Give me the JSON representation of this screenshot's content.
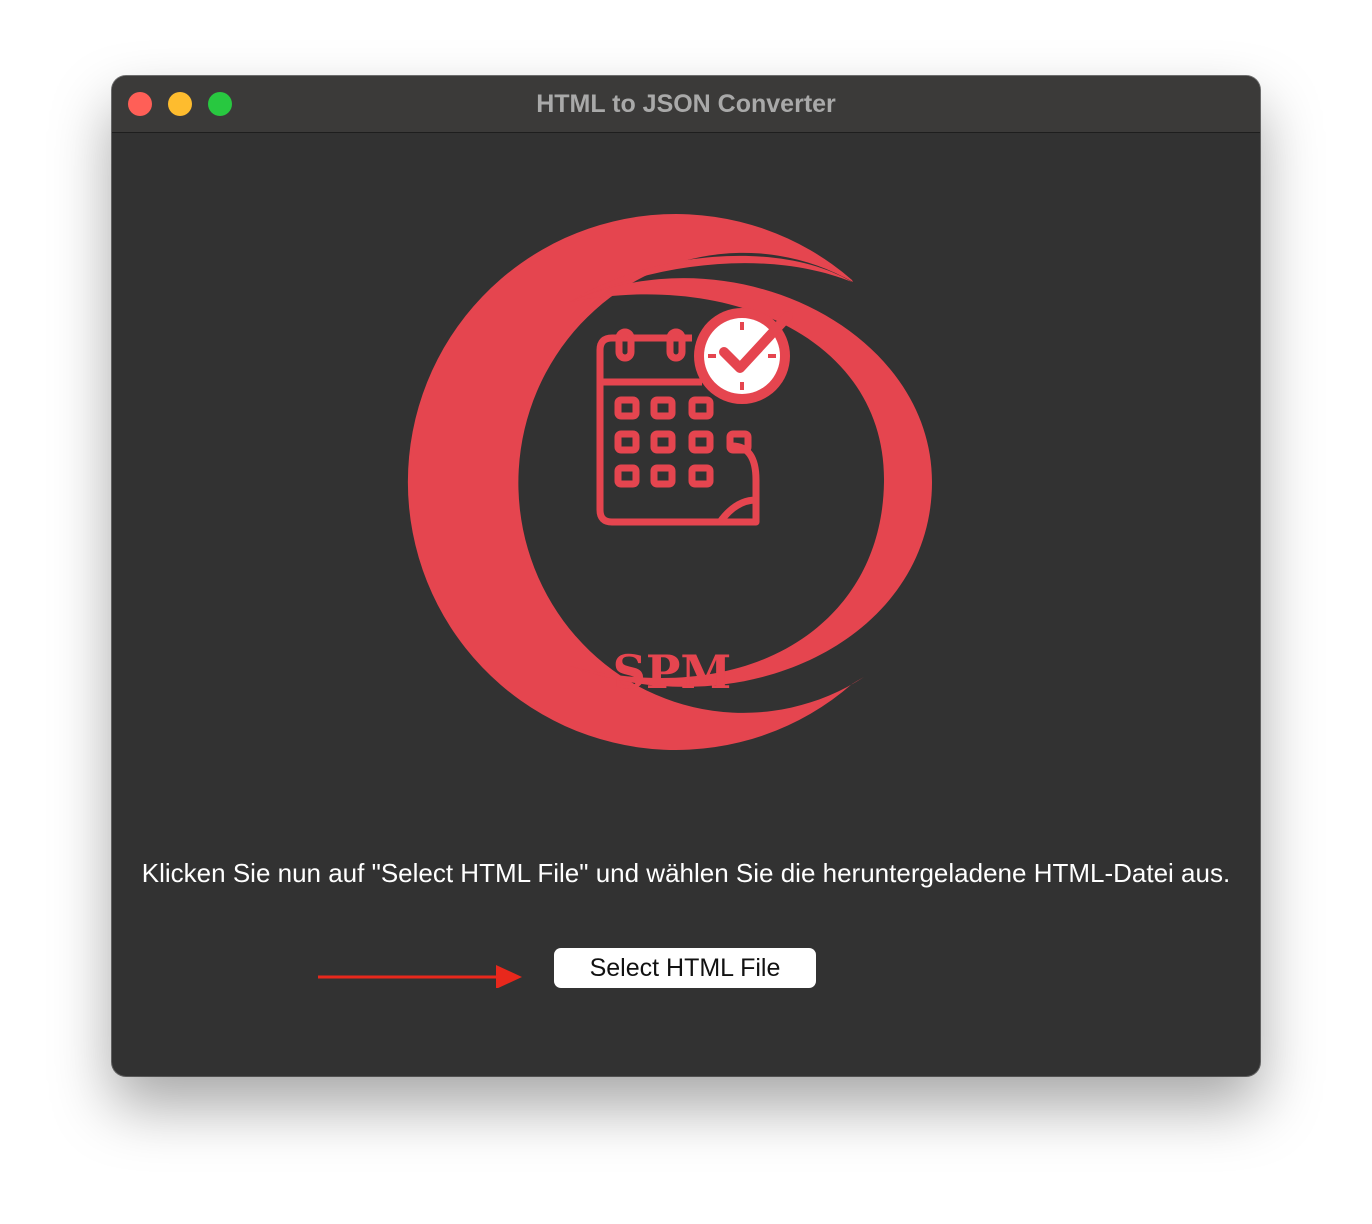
{
  "window": {
    "title": "HTML to JSON Converter"
  },
  "logo": {
    "text": "SPM",
    "accent_color": "#e5454f"
  },
  "main": {
    "instruction": "Klicken Sie nun auf \"Select HTML File\" und wählen Sie die heruntergeladene HTML-Datei aus.",
    "select_button_label": "Select HTML File"
  },
  "icons": {
    "close": "close-traffic-light",
    "minimize": "minimize-traffic-light",
    "zoom": "zoom-traffic-light",
    "logo": "calendar-clock-check-icon",
    "pointer": "red-arrow-icon"
  },
  "colors": {
    "window_bg": "#323232",
    "titlebar_bg": "#3b3a39",
    "arrow": "#e8281c"
  }
}
